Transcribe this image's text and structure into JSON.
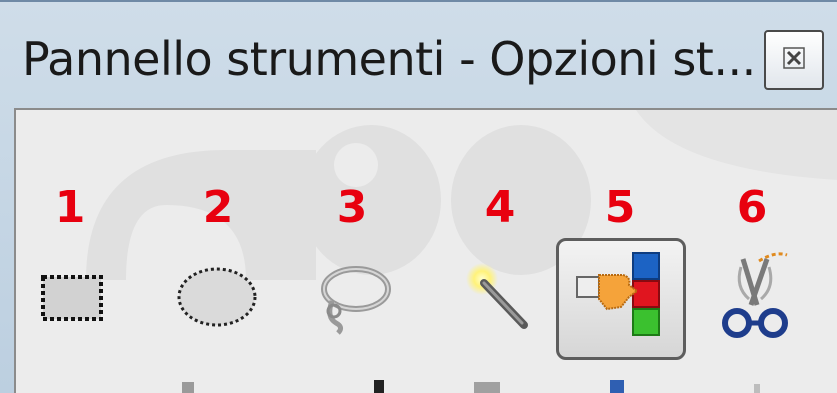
{
  "window": {
    "title": "Pannello strumenti - Opzioni st..."
  },
  "close_button": {
    "icon": "close-icon"
  },
  "tools": [
    {
      "number": "1",
      "icon": "rectangle-select-icon"
    },
    {
      "number": "2",
      "icon": "ellipse-select-icon"
    },
    {
      "number": "3",
      "icon": "free-select-lasso-icon"
    },
    {
      "number": "4",
      "icon": "fuzzy-select-magic-wand-icon"
    },
    {
      "number": "5",
      "icon": "select-by-color-icon",
      "active": true
    },
    {
      "number": "6",
      "icon": "scissors-select-icon"
    }
  ],
  "colors": {
    "number_label": "#e8000f",
    "panel_bg": "#ececec",
    "titlebar": "#c7d8e7"
  }
}
